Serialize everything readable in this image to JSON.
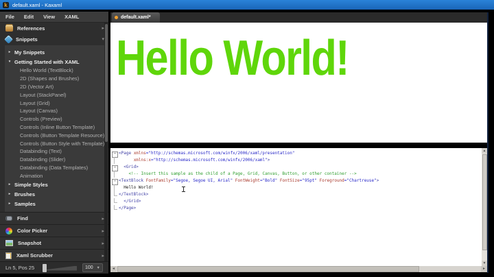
{
  "window": {
    "title": "default.xaml - Kaxaml",
    "icon_letter": "k"
  },
  "menu": {
    "items": [
      "File",
      "Edit",
      "View",
      "XAML"
    ]
  },
  "icons": {
    "chevron-right": "▸",
    "triangle-down": "▾",
    "triangle-right": "▸",
    "dropdown-arrow": "▼",
    "scroll-up": "▲",
    "scroll-down": "▼",
    "scroll-left": "◄",
    "scroll-right": "►"
  },
  "sidebar": {
    "references": {
      "label": "References"
    },
    "snippets": {
      "label": "Snippets"
    },
    "tree": [
      {
        "type": "group",
        "expanded": false,
        "label": "My Snippets"
      },
      {
        "type": "group",
        "expanded": true,
        "label": "Getting Started with XAML"
      },
      {
        "type": "item",
        "label": "Hello World (TextBlock)"
      },
      {
        "type": "item",
        "label": "2D (Shapes and Brushes)"
      },
      {
        "type": "item",
        "label": "2D (Vector Art)"
      },
      {
        "type": "item",
        "label": "Layout (StackPanel)"
      },
      {
        "type": "item",
        "label": "Layout (Grid)"
      },
      {
        "type": "item",
        "label": "Layout (Canvas)"
      },
      {
        "type": "item",
        "label": "Controls (Preview)"
      },
      {
        "type": "item",
        "label": "Controls (Inline Button Template)"
      },
      {
        "type": "item",
        "label": "Controls (Button Template Resource)"
      },
      {
        "type": "item",
        "label": "Controls (Button Style with Template)"
      },
      {
        "type": "item",
        "label": "Databinding (Text)"
      },
      {
        "type": "item",
        "label": "Databinding (Slider)"
      },
      {
        "type": "item",
        "label": "Databinding (Data Templates)"
      },
      {
        "type": "item",
        "label": "Animation"
      },
      {
        "type": "group",
        "expanded": false,
        "label": "Simple Styles"
      },
      {
        "type": "group",
        "expanded": false,
        "label": "Brushes"
      },
      {
        "type": "group",
        "expanded": false,
        "label": "Samples"
      }
    ],
    "tools": [
      {
        "label": "Find",
        "icon": "binoculars-icon"
      },
      {
        "label": "Color Picker",
        "icon": "color-wheel-icon"
      },
      {
        "label": "Snapshot",
        "icon": "snapshot-icon"
      },
      {
        "label": "Xaml Scrubber",
        "icon": "scrubber-icon"
      }
    ]
  },
  "statusbar": {
    "position": "Ln 5, Pos 25",
    "zoom_value": "100"
  },
  "editor": {
    "tab_label": "default.xaml*",
    "preview_text": "Hello World!",
    "preview_color": "#5fd60a",
    "code_lines": [
      {
        "fold": "box",
        "tokens": [
          [
            "tag",
            "<Page "
          ],
          [
            "attr",
            "xmlns"
          ],
          [
            "val",
            "=\"http://schemas.microsoft.com/winfx/2006/xaml/presentation\""
          ]
        ]
      },
      {
        "fold": "bar",
        "tokens": [
          [
            "plain",
            "      "
          ],
          [
            "attr",
            "xmlns:x"
          ],
          [
            "val",
            "=\"http://schemas.microsoft.com/winfx/2006/xaml\""
          ],
          [
            "tag",
            ">"
          ]
        ]
      },
      {
        "fold": "box",
        "tokens": [
          [
            "tag",
            "  <Grid>"
          ]
        ]
      },
      {
        "fold": "bar",
        "tokens": [
          [
            "comment",
            "    <!-- Insert this sample as the child of a Page, Grid, Canvas, Button, or other container -->"
          ]
        ]
      },
      {
        "fold": "box",
        "tokens": [
          [
            "tag",
            "<TextBlock "
          ],
          [
            "attr",
            "FontFamily"
          ],
          [
            "val",
            "=\"Segoe, Segoe UI, Arial\""
          ],
          [
            "attr",
            " FontWeight"
          ],
          [
            "val",
            "=\"Bold\""
          ],
          [
            "attr",
            " FontSize"
          ],
          [
            "val",
            "=\"95pt\""
          ],
          [
            "attr",
            " Foreground"
          ],
          [
            "val",
            "=\"Chartreuse\""
          ],
          [
            "tag",
            ">"
          ]
        ]
      },
      {
        "fold": "bar",
        "tokens": [
          [
            "plain",
            "  Hello World!"
          ]
        ]
      },
      {
        "fold": "corner",
        "tokens": [
          [
            "tag",
            "</TextBlock>"
          ]
        ]
      },
      {
        "fold": "corner",
        "tokens": [
          [
            "tag",
            "  </Grid>"
          ]
        ]
      },
      {
        "fold": "corner",
        "tokens": [
          [
            "tag",
            "</Page>"
          ]
        ]
      }
    ]
  }
}
